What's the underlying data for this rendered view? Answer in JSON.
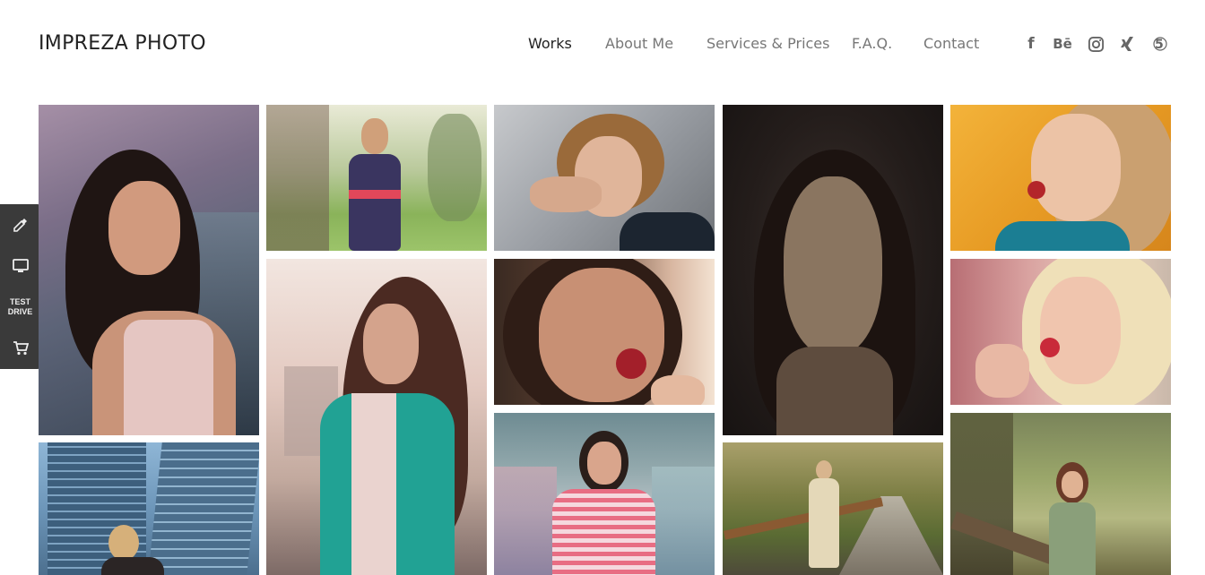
{
  "site": {
    "logo": "IMPREZA PHOTO"
  },
  "nav": {
    "items": [
      {
        "label": "Works",
        "active": true
      },
      {
        "label": "About Me"
      },
      {
        "label": "Services & Prices"
      },
      {
        "label": "F.A.Q."
      },
      {
        "label": "Contact"
      }
    ]
  },
  "social": [
    {
      "name": "facebook-icon",
      "glyph": "f"
    },
    {
      "name": "behance-icon",
      "glyph": "Bē"
    },
    {
      "name": "instagram-icon",
      "glyph": ""
    },
    {
      "name": "xing-icon",
      "glyph": ""
    },
    {
      "name": "500px-icon",
      "glyph": "5"
    }
  ],
  "sidebar": {
    "test_drive_line1": "TEST",
    "test_drive_line2": "DRIVE"
  },
  "gallery": {
    "photos": [
      {
        "name": "photo-brunette-smiling"
      },
      {
        "name": "photo-woman-polka-dress-garden"
      },
      {
        "name": "photo-short-hair-woman"
      },
      {
        "name": "photo-dark-portrait"
      },
      {
        "name": "photo-blonde-lollipop-orange"
      },
      {
        "name": "photo-woman-teal-jacket"
      },
      {
        "name": "photo-brunette-lollipop"
      },
      {
        "name": "photo-blonde-lollipop-closeup"
      },
      {
        "name": "photo-skyscrapers-pose"
      },
      {
        "name": "photo-striped-shirt-graffiti"
      },
      {
        "name": "photo-boardwalk-woman"
      },
      {
        "name": "photo-woman-tree-park"
      }
    ]
  },
  "colors": {
    "sidebar_bg": "#3a3a3a",
    "nav_active": "#222222",
    "nav_inactive": "#777777"
  }
}
